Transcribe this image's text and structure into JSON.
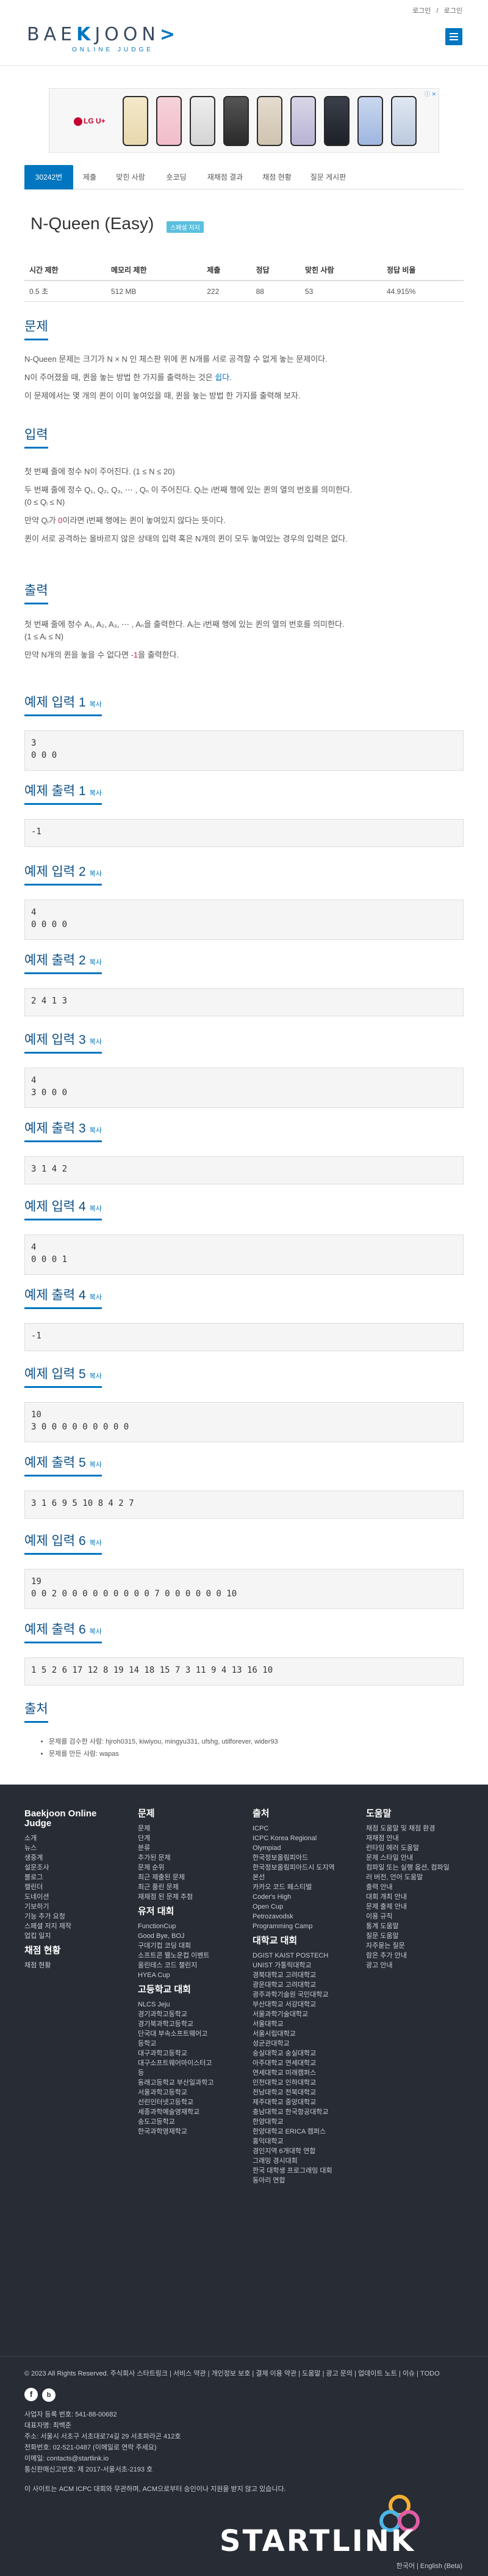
{
  "header": {
    "logo_main_a": "BAE",
    "logo_bracket": "K",
    "logo_main_b": "JOON",
    "logo_arrow": ">",
    "logo_sub": "ONLINE JUDGE",
    "login": "로그인",
    "separator": "/",
    "register": "로그인"
  },
  "ad": {
    "brand": "LG U+",
    "close": "ⓘ ✕"
  },
  "tabs": [
    "30242번",
    "제출",
    "맞힌 사람",
    "숏코딩",
    "재채점 결과",
    "채점 현황",
    "질문 게시판"
  ],
  "problem": {
    "title": "N-Queen (Easy)",
    "badge": "스페셜 저지",
    "table_headers": [
      "시간 제한",
      "메모리 제한",
      "제출",
      "정답",
      "맞힌 사람",
      "정답 비율"
    ],
    "table_values": [
      "0.5 초",
      "512 MB",
      "222",
      "88",
      "53",
      "44.915%"
    ]
  },
  "sections": {
    "problem": "문제",
    "input": "입력",
    "output": "출력",
    "source": "출처"
  },
  "problem_text": {
    "p1": "N-Queen 문제는 크기가 N × N 인 체스판 위에 퀸 N개를 서로 공격할 수 없게 놓는 문제이다.",
    "p2_a": "N이 주어졌을 때, 퀸을 놓는 방법 한 가지를 출력하는 것은 ",
    "p2_link": "쉽다",
    "p2_b": ".",
    "p3": "이 문제에서는 몇 개의 퀸이 이미 놓여있을 때, 퀸을 놓는 방법 한 가지를 출력해 보자."
  },
  "input_text": {
    "p1": "첫 번째 줄에 정수 N이 주어진다. (1 ≤ N ≤ 20)",
    "p2": "두 번째 줄에 정수 Q₁, Q₂, Q₃, ⋯ , Qₙ 이 주어진다. Qᵢ는 i번째 행에 있는 퀸의 열의 번호를 의미한다.",
    "p2b": "(0 ≤ Qᵢ ≤ N)",
    "p3_a": "만약 Qᵢ가 ",
    "p3_red": "0",
    "p3_b": "이라면 i번째 행에는 퀸이 놓여있지 않다는 뜻이다.",
    "p4": "퀸이 서로 공격하는 올바르지 않은 상태의 입력 혹은 N개의 퀸이 모두 놓여있는 경우의 입력은 없다."
  },
  "output_text": {
    "p1": "첫 번째 줄에 정수 A₁, A₂, A₃, ⋯ , Aₙ을 출력한다. Aᵢ는 i번째 행에 있는 퀸의 열의 번호를 의미한다.",
    "p1b": "(1 ≤ Aᵢ ≤ N)",
    "p2_a": "만약 N개의 퀸을 놓을 수 없다면 ",
    "p2_red": "-1",
    "p2_b": "을 출력한다."
  },
  "copy_label": "복사",
  "samples": [
    {
      "in_title": "예제 입력 1",
      "in": "3\n0 0 0",
      "out_title": "예제 출력 1",
      "out": "-1"
    },
    {
      "in_title": "예제 입력 2",
      "in": "4\n0 0 0 0",
      "out_title": "예제 출력 2",
      "out": "2 4 1 3"
    },
    {
      "in_title": "예제 입력 3",
      "in": "4\n3 0 0 0",
      "out_title": "예제 출력 3",
      "out": "3 1 4 2"
    },
    {
      "in_title": "예제 입력 4",
      "in": "4\n0 0 0 1",
      "out_title": "예제 출력 4",
      "out": "-1"
    },
    {
      "in_title": "예제 입력 5",
      "in": "10\n3 0 0 0 0 0 0 0 0 0",
      "out_title": "예제 출력 5",
      "out": "3 1 6 9 5 10 8 4 2 7"
    },
    {
      "in_title": "예제 입력 6",
      "in": "19\n0 0 2 0 0 0 0 0 0 0 0 0 7 0 0 0 0 0 0 10",
      "out_title": "예제 출력 6",
      "out": "1 5 2 6 17 12 8 19 14 18 15 7 3 11 9 4 13 16 10"
    }
  ],
  "source": [
    "문제를 검수한 사람: hjroh0315, kiwiyou, mingyu331, ufshg, utilforever, wider93",
    "문제를 만든 사람: wapas"
  ],
  "footer": {
    "col1_title": "Baekjoon Online Judge",
    "col1_items": [
      "소개",
      "뉴스",
      "생중계",
      "설문조사",
      "블로그",
      "캘린더",
      "도네이션",
      "기보하기",
      "기능 추가 요청",
      "스페셜 저지 제작",
      "업킵 일지"
    ],
    "col1_sub": "채점 현황",
    "col1_sub_items": [
      "채점 현황"
    ],
    "col2_title": "문제",
    "col2_items": [
      "문제",
      "단계",
      "분류",
      "추가된 문제",
      "문제 순위",
      "최근 제출된 문제",
      "최근 풀린 문제",
      "재채점 된 문제 추첨"
    ],
    "col2_sub": "유저 대회",
    "col2_sub_items": [
      "FunctionCup",
      "Good Bye, BOJ",
      "구데기컵 코딩 대회",
      "소프트콘 웰노운컵 이벤트",
      "올린테스 코드 챌린지",
      "HYEA Cup"
    ],
    "col2_sub2": "고등학교 대회",
    "col2_sub2_items": [
      "NLCS Jeju",
      "경기과학고등학교",
      "경기북과학고등학교",
      "단국대 부속소프트웨어고",
      "등학교",
      "대구과학고등학교",
      "대구소프트웨어마이스터고",
      "등",
      "동래고등학교 부산일과학고",
      "서울과학고등학교",
      "선린인터넷고등학교",
      "세종과학예술영재학교",
      "송도고등학교",
      "한국과학영재학교"
    ],
    "col3_title": "출처",
    "col3_items": [
      "ICPC",
      "ICPC Korea Regional",
      "Olympiad",
      "한국정보올림피아드",
      "한국정보올림피아드시 도지역",
      "본선",
      "카카오 코드 페스티벌",
      "Coder's High",
      "Open Cup",
      "Petrozavodsk",
      "Programming Camp"
    ],
    "col3_sub": "대학교 대회",
    "col3_sub_items": [
      "DGIST KAIST POSTECH",
      "UNIST 가톨릭대학교",
      "경북대학교 고려대학교",
      "광운대학교 고려대학교",
      "광주과학기술원 국민대학교",
      "부산대학교 서강대학교",
      "서울과학기술대학교",
      "서울대학교",
      "서울시립대학교",
      "성균관대학교",
      "숭실대학교 숭실대학교",
      "아주대학교 연세대학교",
      "연세대학교 미래캠퍼스",
      "인천대학교 인하대학교",
      "전남대학교 전북대학교",
      "제주대학교 중앙대학교",
      "충남대학교 한국항공대학교",
      "한양대학교",
      "한양대학교 ERICA 캠퍼스",
      "홍익대학교",
      "경인지역 6개대학 연합",
      "그래밍 경시대회",
      "한국 대학생 프로그래밍 대회",
      "동아리 연합"
    ],
    "col4_title": "도움말",
    "col4_items": [
      "채점 도움말 및 채점 환경",
      "재채점 안내",
      "런타임 에러 도움말",
      "문제 스타일 안내",
      "컴파일 또는 실행 옵션, 컴파일",
      "러 버전, 언어 도움말",
      "출력 안내",
      "대회 개최 안내",
      "문제 출제 안내",
      "이용 규칙",
      "통계 도움말",
      "질문 도움말",
      "자주묻는 질문",
      "람은 추가 안내",
      "광고 안내"
    ],
    "copyright": "© 2023 All Rights Reserved. 주식회사 스타트링크",
    "bottom_links": [
      "서비스 약관",
      "개인정보 보호",
      "결제 이용 약관",
      "도움말",
      "광고 문의",
      "업데이트 노트",
      "이슈",
      "TODO"
    ],
    "biz": [
      "사업자 등록 번호: 541-88-00682",
      "대표자명: 최백준",
      "주소: 서울시 서초구 서초대로74길 29 서초파라곤 412호",
      "전화번호: 02-521-0487 (이메일로 연락 주세요)",
      "이메일: contacts@startlink.io",
      "통신판매신고번호: 제 2017-서울서초-2193 호"
    ],
    "disclaimer": "이 사이트는 ACM ICPC 대회와 무관하며, ACM으로부터 승인이나 지원을 받지 않고 있습니다.",
    "lang": "한국어 | English (Beta)",
    "startlink": "STARTLINK"
  }
}
